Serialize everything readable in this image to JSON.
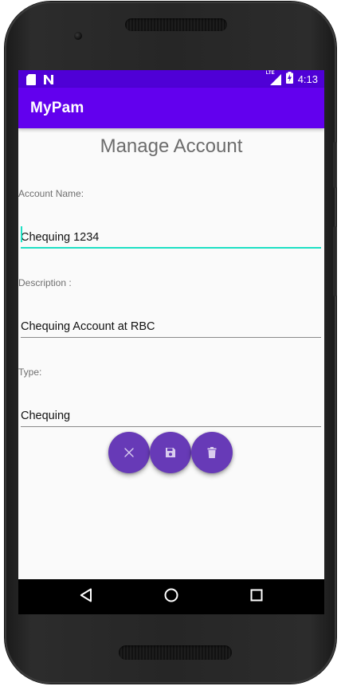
{
  "status_bar": {
    "time": "4:13",
    "network_label": "LTE",
    "icons": [
      "sd-card-icon",
      "n-notification-icon",
      "signal-icon",
      "battery-charging-icon"
    ]
  },
  "app_bar": {
    "title": "MyPam"
  },
  "page": {
    "title": "Manage Account"
  },
  "form": {
    "account_name": {
      "label": "Account Name:",
      "value": "Chequing 1234",
      "focused": true
    },
    "description": {
      "label": "Description :",
      "value": "Chequing Account at RBC"
    },
    "type": {
      "label": "Type:",
      "value": "Chequing"
    }
  },
  "actions": [
    {
      "name": "cancel-button",
      "icon": "close-icon"
    },
    {
      "name": "save-button",
      "icon": "floppy-disk-icon"
    },
    {
      "name": "delete-button",
      "icon": "trash-icon"
    }
  ],
  "navigation": {
    "buttons": [
      "back-icon",
      "home-icon",
      "recents-icon"
    ]
  },
  "colors": {
    "status_bar": "#4f00d6",
    "app_bar": "#6200ee",
    "fab": "#673ab7",
    "accent": "#1ee0c4",
    "background": "#fafafa"
  }
}
